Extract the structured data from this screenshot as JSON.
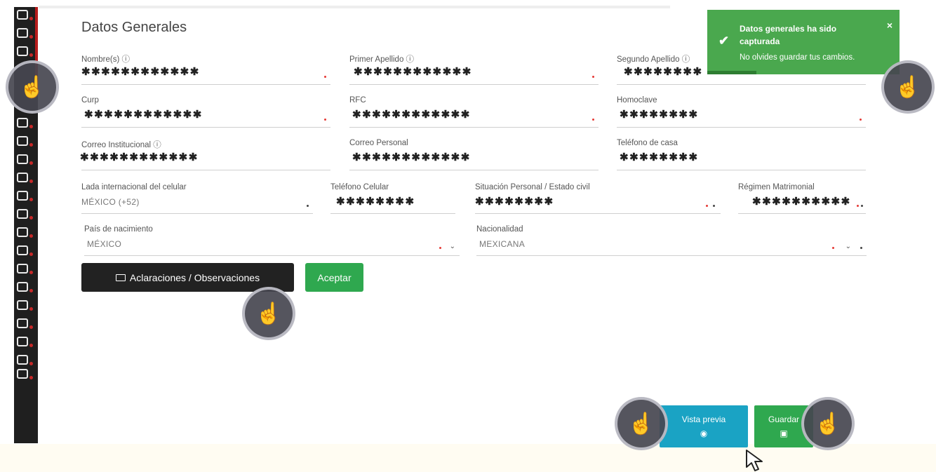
{
  "page": {
    "title": "Datos Generales"
  },
  "fields": {
    "nombre": {
      "label": "Nombre(s) ⓘ",
      "value": "✱✱✱✱✱✱✱✱✱✱✱✱"
    },
    "primer_apellido": {
      "label": "Primer Apellido ⓘ",
      "value": "✱✱✱✱✱✱✱✱✱✱✱✱"
    },
    "segundo_apellido": {
      "label": "Segundo Apellido ⓘ",
      "value": "✱✱✱✱✱✱✱✱"
    },
    "curp": {
      "label": "Curp",
      "value": "✱✱✱✱✱✱✱✱✱✱✱✱"
    },
    "rfc": {
      "label": "RFC",
      "value": "✱✱✱✱✱✱✱✱✱✱✱✱"
    },
    "homoclave": {
      "label": "Homoclave",
      "value": "✱✱✱✱✱✱✱✱"
    },
    "correo_institucional": {
      "label": "Correo Institucional ⓘ",
      "value": "✱✱✱✱✱✱✱✱✱✱✱✱"
    },
    "correo_personal": {
      "label": "Correo Personal",
      "value": "✱✱✱✱✱✱✱✱✱✱✱✱"
    },
    "telefono_casa": {
      "label": "Teléfono de casa",
      "value": "✱✱✱✱✱✱✱✱"
    },
    "lada": {
      "label": "Lada internacional del celular",
      "value": "MÉXICO (+52)"
    },
    "telefono_celular": {
      "label": "Teléfono Celular",
      "value": "✱✱✱✱✱✱✱✱"
    },
    "situacion_personal": {
      "label": "Situación Personal / Estado civil",
      "value": "✱✱✱✱✱✱✱✱"
    },
    "regimen": {
      "label": "Régimen Matrimonial",
      "value": "✱✱✱✱✱✱✱✱✱✱"
    },
    "pais_nacimiento": {
      "label": "País de nacimiento",
      "value": "MÉXICO"
    },
    "nacionalidad": {
      "label": "Nacionalidad",
      "value": "MEXICANA"
    }
  },
  "buttons": {
    "aclaraciones": "Aclaraciones / Observaciones",
    "aceptar": "Aceptar",
    "vista_previa": "Vista previa",
    "guardar": "Guardar"
  },
  "toast": {
    "title": "Datos generales ha sido capturada",
    "message": "No olvides guardar tus cambios.",
    "close": "×"
  },
  "icons": {
    "check": "✔",
    "eye": "◉",
    "save": "▣",
    "touch": "☝",
    "select_arrow": "⌄"
  },
  "colors": {
    "toast_bg": "#4aa84e",
    "accept_green": "#2fa84f",
    "preview_blue": "#1aa3c4",
    "dark_button": "#222222",
    "required_dot": "#e53935"
  }
}
